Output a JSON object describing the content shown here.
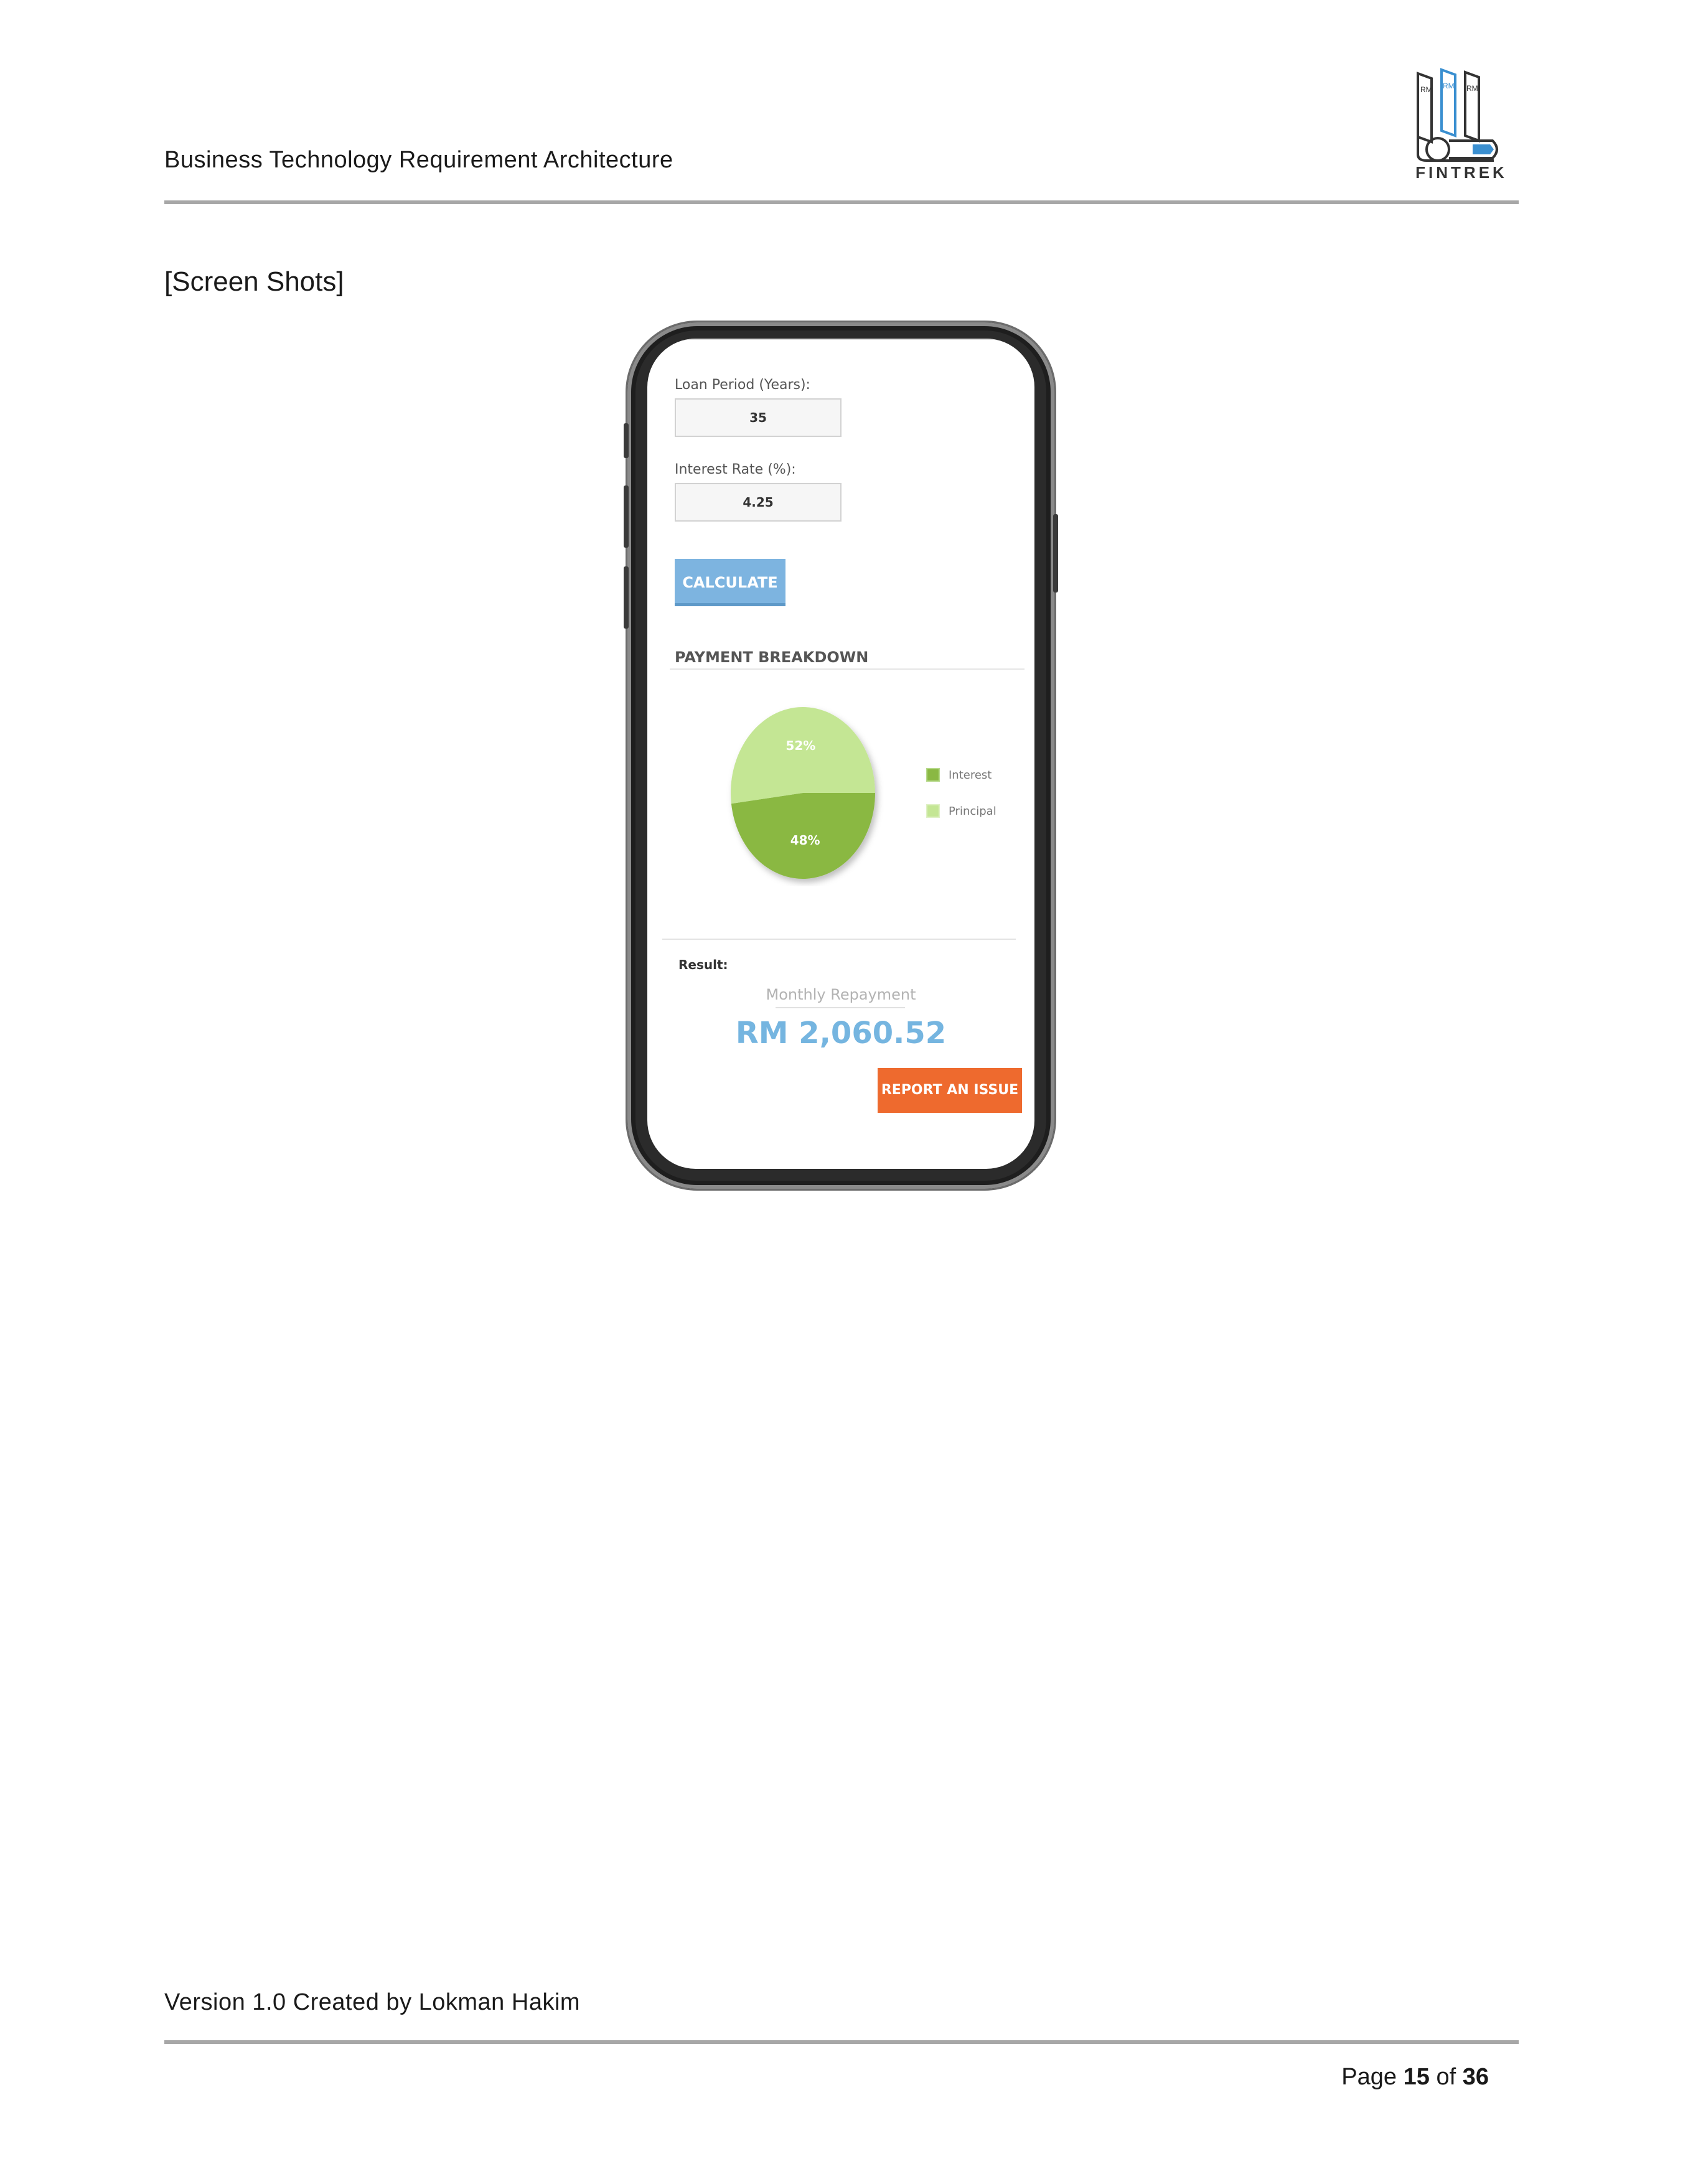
{
  "header": {
    "title": "Business Technology Requirement Architecture",
    "logo_text": "FINTREK",
    "logo_sublabels": [
      "RM",
      "RM",
      "RM"
    ]
  },
  "section_title": "[Screen Shots]",
  "phone_screen": {
    "loan_period_label": "Loan Period (Years):",
    "loan_period_value": "35",
    "interest_rate_label": "Interest Rate (%):",
    "interest_rate_value": "4.25",
    "calculate_label": "CALCULATE",
    "breakdown_title": "PAYMENT BREAKDOWN",
    "result_label": "Result:",
    "monthly_repayment_label": "Monthly Repayment",
    "monthly_repayment_value": "RM 2,060.52",
    "report_label": "REPORT AN ISSUE",
    "colors": {
      "interest": "#8ab843",
      "principal": "#c4e694",
      "accent_blue": "#7db4e0",
      "report_orange": "#ee6a2e"
    }
  },
  "chart_data": {
    "type": "pie",
    "categories": [
      "Interest",
      "Principal"
    ],
    "values": [
      48,
      52
    ],
    "labels": [
      "48%",
      "52%"
    ],
    "legend": [
      "Interest",
      "Principal"
    ],
    "legend_position": "right"
  },
  "footer": {
    "text": "Version 1.0 Created by Lokman Hakim",
    "page_prefix": "Page",
    "page_current": "15",
    "page_of": "of",
    "page_total": "36"
  }
}
